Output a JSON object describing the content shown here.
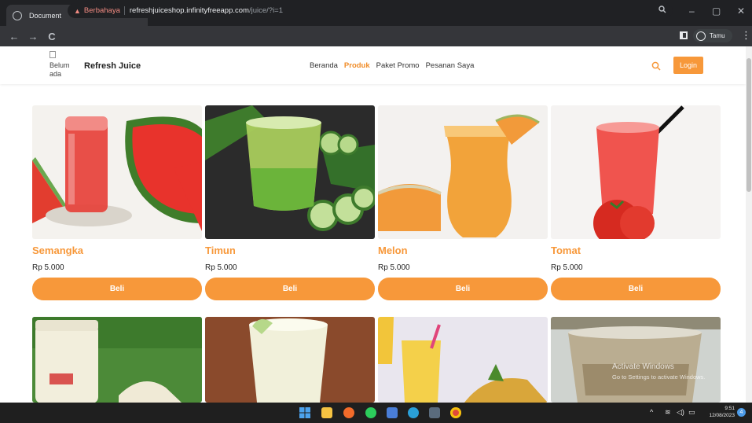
{
  "browser": {
    "tab_title": "Document",
    "tab_close": "×",
    "new_tab": "+",
    "security_warning": "Berbahaya",
    "url_host": "refreshjuiceshop.infinityfreeapp.com",
    "url_path": "/juice/?i=1",
    "profile_name": "Tamu",
    "window_min": "–",
    "window_max": "▢",
    "window_close": "✕",
    "back": "←",
    "forward": "→",
    "reload": "C",
    "menu": "⋮"
  },
  "site": {
    "logo_alt": "Belum ada",
    "brand": "Refresh Juice",
    "nav": [
      {
        "label": "Beranda"
      },
      {
        "label": "Produk"
      },
      {
        "label": "Paket Promo"
      },
      {
        "label": "Pesanan Saya"
      }
    ],
    "login_label": "Login"
  },
  "products": [
    {
      "name": "Semangka",
      "price": "Rp 5.000",
      "button": "Beli"
    },
    {
      "name": "Timun",
      "price": "Rp 5.000",
      "button": "Beli"
    },
    {
      "name": "Melon",
      "price": "Rp 5.000",
      "button": "Beli"
    },
    {
      "name": "Tomat",
      "price": "Rp 5.000",
      "button": "Beli"
    }
  ],
  "watermark": {
    "line1": "Activate Windows",
    "line2": "Go to Settings to activate Windows."
  },
  "taskbar": {
    "time": "9:51",
    "date": "12/08/2023",
    "notifications": "4"
  },
  "colors": {
    "accent": "#f7983a",
    "browser_dark": "#202124",
    "warning": "#f28b82"
  }
}
